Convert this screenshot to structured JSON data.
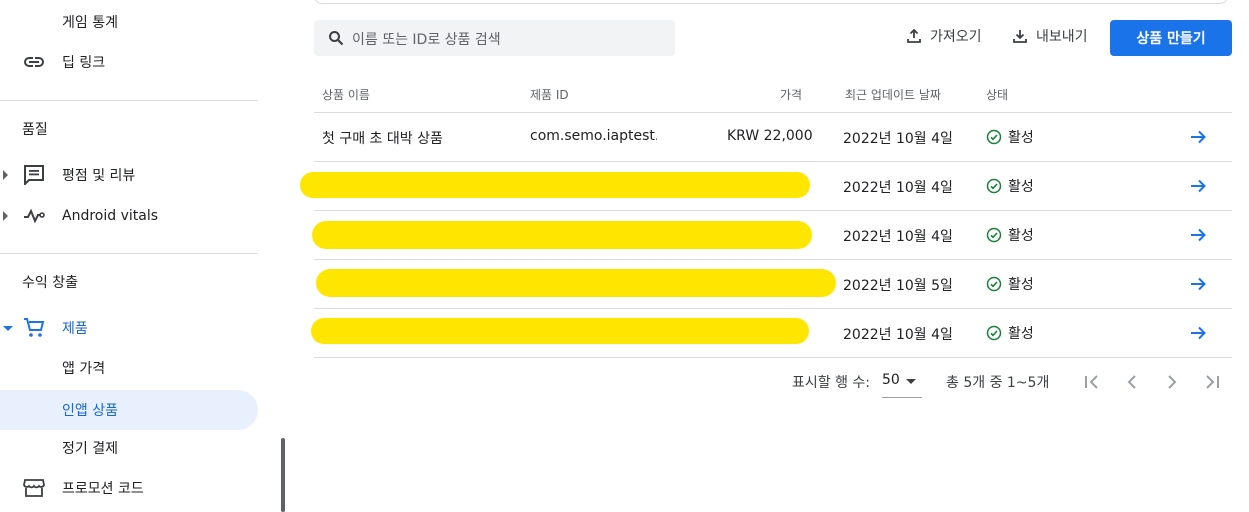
{
  "sidebar": {
    "game_stats_label": "게임 통계",
    "deep_link_label": "딥 링크",
    "quality_title": "품질",
    "ratings_label": "평점 및 리뷰",
    "vitals_label": "Android vitals",
    "monetize_title": "수익 창출",
    "products_label": "제품",
    "app_price_label": "앱 가격",
    "iap_label": "인앱 상품",
    "subscriptions_label": "정기 결제",
    "promo_codes_label": "프로모션 코드"
  },
  "toolbar": {
    "search_placeholder": "이름 또는 ID로 상품 검색",
    "import_label": "가져오기",
    "export_label": "내보내기",
    "create_label": "상품 만들기"
  },
  "table": {
    "headers": {
      "name": "상품 이름",
      "id": "제품 ID",
      "price": "가격",
      "updated": "최근 업데이트 날짜",
      "status": "상태"
    },
    "rows": [
      {
        "name": "첫 구매 초 대박 상품",
        "id": "com.semo.iaptest.re",
        "price": "KRW 22,000",
        "updated": "2022년 10월 4일",
        "status": "활성"
      },
      {
        "name": "",
        "id": "",
        "price": "",
        "updated": "2022년 10월 4일",
        "status": "활성"
      },
      {
        "name": "",
        "id": "",
        "price": "",
        "updated": "2022년 10월 4일",
        "status": "활성"
      },
      {
        "name": "",
        "id": "",
        "price": "",
        "updated": "2022년 10월 5일",
        "status": "활성"
      },
      {
        "name": "",
        "id": "",
        "price": "",
        "updated": "2022년 10월 4일",
        "status": "활성"
      }
    ]
  },
  "pagination": {
    "rows_per_page_label": "표시할 행 수:",
    "rows_per_page_value": "50",
    "range_text": "총 5개 중 1~5개"
  },
  "colors": {
    "accent": "#1a73e8",
    "active_bg": "#e8f0fe",
    "status_green": "#188038",
    "redaction": "#ffe600"
  }
}
